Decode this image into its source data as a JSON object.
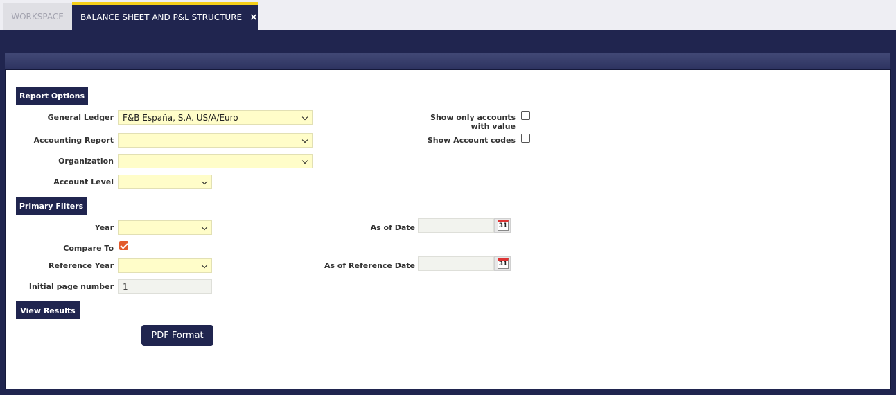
{
  "tabs": {
    "workspace": "WORKSPACE",
    "active": "BALANCE SHEET AND P&L STRUCTURE",
    "close": "×"
  },
  "sections": {
    "report_options": "Report Options",
    "primary_filters": "Primary Filters",
    "view_results": "View Results"
  },
  "fields": {
    "general_ledger": {
      "label": "General Ledger",
      "value": "F&B España, S.A. US/A/Euro"
    },
    "accounting_report": {
      "label": "Accounting Report",
      "value": ""
    },
    "organization": {
      "label": "Organization",
      "value": ""
    },
    "account_level": {
      "label": "Account Level",
      "value": ""
    },
    "show_only_accounts": {
      "label_line1": "Show only accounts",
      "label_line2": "with value",
      "checked": false
    },
    "show_account_codes": {
      "label": "Show Account codes",
      "checked": false
    },
    "year": {
      "label": "Year",
      "value": ""
    },
    "as_of_date": {
      "label": "As of Date",
      "value": ""
    },
    "compare_to": {
      "label": "Compare To",
      "checked": true
    },
    "reference_year": {
      "label": "Reference Year",
      "value": ""
    },
    "as_of_reference_date": {
      "label": "As of Reference Date",
      "value": ""
    },
    "initial_page_number": {
      "label": "Initial page number",
      "value": "1"
    }
  },
  "calendar_icon_text": "31",
  "buttons": {
    "pdf_format": "PDF Format"
  }
}
